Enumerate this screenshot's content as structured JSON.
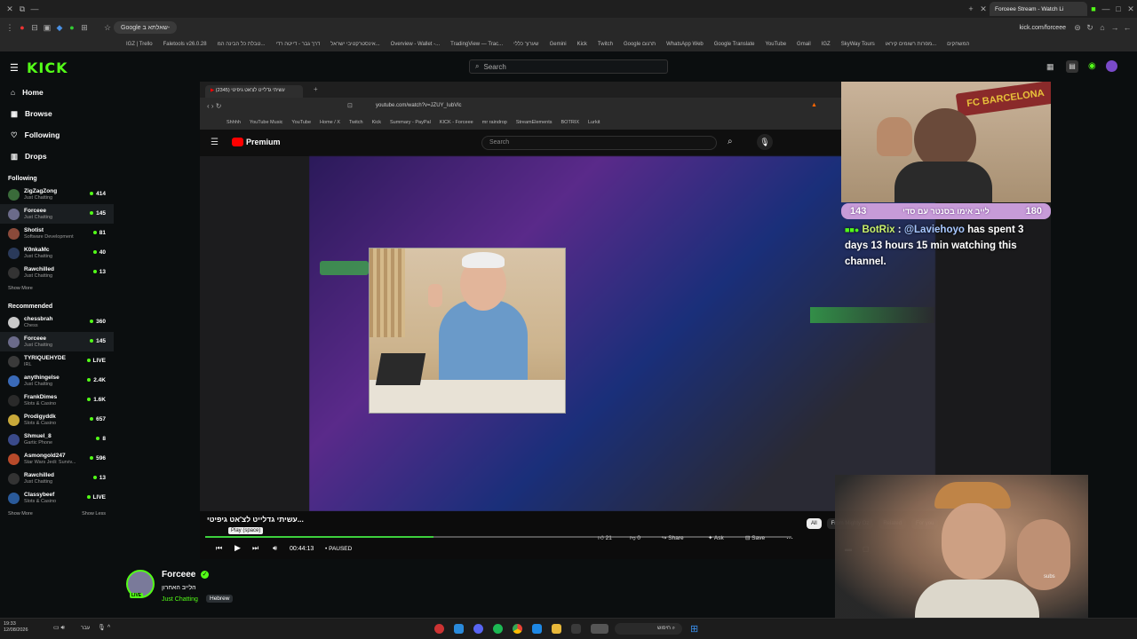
{
  "browser": {
    "tab_title": "Forceee Stream - Watch Li",
    "url": "kick.com/forceee",
    "search_chip": "Google שאלתא ב-",
    "bookmarks": [
      "IGZ | Trello",
      "Faletools v26.0.28",
      "טבלת כל הבינה המ...",
      "דרך גבר - דייטה רדי",
      "אינסטרקטיבי ישראל...",
      "Overview - Wallet -...",
      "TradingView — Trac...",
      "שערוך כללי",
      "Gemini",
      "Kick",
      "Twitch",
      "Google תרגום",
      "WhatsApp Web",
      "Google Translate",
      "YouTube",
      "Gmail",
      "IGZ",
      "SkyWay Tours",
      "מפרות רשומים קיראו...",
      "המשחקים"
    ]
  },
  "kick": {
    "logo": "KICK",
    "search_placeholder": "Search",
    "nav": [
      {
        "label": "Home",
        "icon": "home-icon"
      },
      {
        "label": "Browse",
        "icon": "browse-icon"
      },
      {
        "label": "Following",
        "icon": "heart-icon"
      },
      {
        "label": "Drops",
        "icon": "drops-icon"
      }
    ],
    "following_title": "Following",
    "following": [
      {
        "name": "ZigZagZong",
        "cat": "Just Chatting",
        "count": "414",
        "color": "#3a6b3a"
      },
      {
        "name": "Forceee",
        "cat": "Just Chatting",
        "count": "145",
        "color": "#6b6b8a",
        "sel": true
      },
      {
        "name": "Shotist",
        "cat": "Software Development",
        "count": "81",
        "color": "#8a4a3a"
      },
      {
        "name": "K0nkaMc",
        "cat": "Just Chatting",
        "count": "40",
        "color": "#2a3a5a"
      },
      {
        "name": "Rawchilled",
        "cat": "Just Chatting",
        "count": "13",
        "color": "#333"
      }
    ],
    "show_more": "Show More",
    "recommended_title": "Recommended",
    "recommended": [
      {
        "name": "chessbrah",
        "cat": "Chess",
        "count": "360",
        "color": "#c9c9c9"
      },
      {
        "name": "Forceee",
        "cat": "Just Chatting",
        "count": "145",
        "color": "#6b6b8a",
        "sel": true
      },
      {
        "name": "TYRIQUEHYDE",
        "cat": "IRL",
        "count": "LIVE",
        "color": "#3a3a3a"
      },
      {
        "name": "anythingelse",
        "cat": "Just Chatting",
        "count": "2.4K",
        "color": "#3a6ab8"
      },
      {
        "name": "FrankDimes",
        "cat": "Slots & Casino",
        "count": "1.6K",
        "color": "#2a2a2a"
      },
      {
        "name": "Prodigyddk",
        "cat": "Slots & Casino",
        "count": "657",
        "color": "#c9a93a"
      },
      {
        "name": "Shmuel_8",
        "cat": "Gartic Phone",
        "count": "8",
        "color": "#3a4a8a"
      },
      {
        "name": "Asmongold247",
        "cat": "Star Wars Jedi: Surviv...",
        "count": "596",
        "color": "#b84a2a"
      },
      {
        "name": "Rawchilled",
        "cat": "Just Chatting",
        "count": "13",
        "color": "#333"
      },
      {
        "name": "Classybeef",
        "cat": "Slots & Casino",
        "count": "LIVE",
        "color": "#2a5a9a"
      }
    ],
    "show_less": "Show Less"
  },
  "stream": {
    "inner_tab": "עשיתי גדלייט לצ'אט גיפיטי (2345)",
    "inner_url": "youtube.com/watch?v=JZUY_IubVlc",
    "inner_bookmarks": [
      "Shhhh",
      "YouTube Music",
      "YouTube",
      "Home / X",
      "Twitch",
      "Kick",
      "Summary - PayPal",
      "KICK - Forceee",
      "mr raindrop",
      "StreamElements",
      "BOTRIX",
      "Lurkit"
    ],
    "yt_brand": "Premium",
    "yt_search": "Search",
    "video_title": "...עשיתי גדלייט לצ'אט גיפיטי",
    "tooltip": "Play (space)",
    "time": "00:44:13",
    "status": "PAUSED",
    "progress": 0.39,
    "likes": "21",
    "dislikes": "0",
    "share": "Share",
    "ask": "Ask",
    "save": "Save",
    "chips": [
      "All",
      "From Mighty Oz",
      "Related",
      "For you"
    ],
    "subs": "subs"
  },
  "overlay": {
    "banner_left": "143",
    "banner_center": "לייב אימו בסנטר עם סדי",
    "banner_right": "180",
    "chat_user": "BotRix",
    "chat_mention": "@Laviehoyo",
    "chat_text": " has spent 3 days 13 hours 15 min watching this channel.",
    "sign": "FC BARCELONA"
  },
  "channel": {
    "name": "Forceee",
    "title": "הלייב האחרון",
    "category": "Just Chatting",
    "tag": "Hebrew",
    "live_badge": "LIVE"
  },
  "taskbar": {
    "time": "19:33",
    "date": "12/08/2026",
    "lang": "עבר",
    "search": "חיפוש"
  },
  "colors": {
    "kick_green": "#53fc18",
    "banner": "#c79bd8",
    "yt_red": "#ff0000"
  }
}
